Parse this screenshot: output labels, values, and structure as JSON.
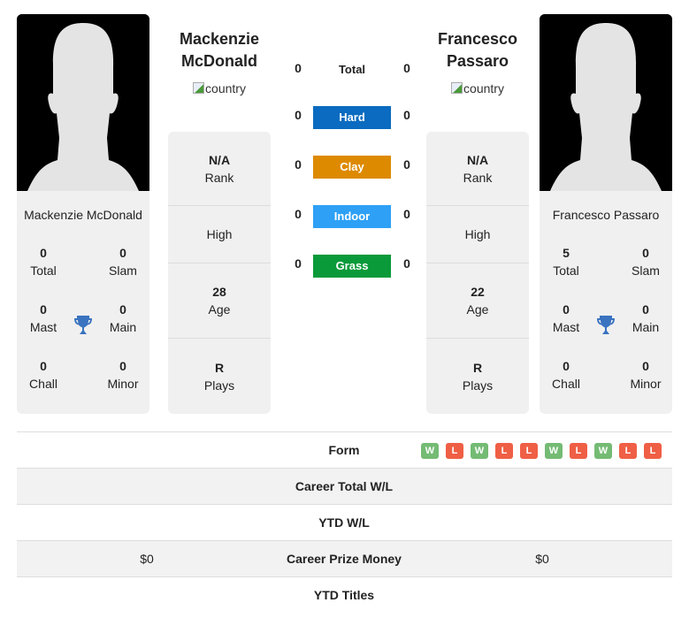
{
  "player1": {
    "name": "Mackenzie McDonald",
    "name_line1": "Mackenzie",
    "name_line2": "McDonald",
    "country_alt": "country",
    "titles": {
      "total": "0",
      "slam": "0",
      "mast": "0",
      "main": "0",
      "chall": "0",
      "minor": "0"
    },
    "rank": "N/A",
    "high": "High",
    "age": "28",
    "plays": "R",
    "career_prize_money": "$0"
  },
  "player2": {
    "name": "Francesco Passaro",
    "name_line1": "Francesco",
    "name_line2": "Passaro",
    "country_alt": "country",
    "titles": {
      "total": "5",
      "slam": "0",
      "mast": "0",
      "main": "0",
      "chall": "0",
      "minor": "0"
    },
    "rank": "N/A",
    "high": "High",
    "age": "22",
    "plays": "R",
    "career_prize_money": "$0"
  },
  "title_labels": {
    "total": "Total",
    "slam": "Slam",
    "mast": "Mast",
    "main": "Main",
    "chall": "Chall",
    "minor": "Minor"
  },
  "info_labels": {
    "rank": "Rank",
    "age": "Age",
    "plays": "Plays"
  },
  "h2h": [
    {
      "label": "Total",
      "p1": "0",
      "p2": "0",
      "color": null
    },
    {
      "label": "Hard",
      "p1": "0",
      "p2": "0",
      "color": "#0a6bc0"
    },
    {
      "label": "Clay",
      "p1": "0",
      "p2": "0",
      "color": "#dd8a00"
    },
    {
      "label": "Indoor",
      "p1": "0",
      "p2": "0",
      "color": "#2ea0f5"
    },
    {
      "label": "Grass",
      "p1": "0",
      "p2": "0",
      "color": "#0a9a3a"
    }
  ],
  "table": {
    "form_label": "Form",
    "form": [
      "W",
      "L",
      "W",
      "L",
      "L",
      "W",
      "L",
      "W",
      "L",
      "L"
    ],
    "form_colors": {
      "W": "#74bb74",
      "L": "#ef5f45"
    },
    "career_wl_label": "Career Total W/L",
    "ytd_wl_label": "YTD W/L",
    "prize_label": "Career Prize Money",
    "ytd_titles_label": "YTD Titles"
  }
}
